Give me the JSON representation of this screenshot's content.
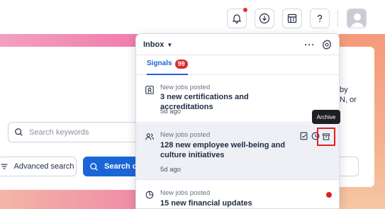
{
  "background": {
    "search_placeholder": "Search keywords",
    "advanced_search_label": "Advanced search",
    "search_button_label": "Search c",
    "right_text_lines": [
      "by",
      "N, or"
    ]
  },
  "inbox": {
    "title": "Inbox",
    "tab_label": "Signals",
    "tab_count": "99",
    "tooltip": "Archive",
    "items": [
      {
        "kicker": "New jobs posted",
        "title": "3 new certifications and accreditations",
        "time": "5d ago"
      },
      {
        "kicker": "New jobs posted",
        "title": "128 new employee well-being and culture initiatives",
        "time": "5d ago"
      },
      {
        "kicker": "New jobs posted",
        "title": "15 new financial updates",
        "time": ""
      }
    ]
  },
  "colors": {
    "accent": "#1a66d6",
    "badge": "#d92d2d",
    "highlight_frame": "#e02020"
  },
  "icons": [
    "bell-icon",
    "download-icon",
    "building-icon",
    "help-icon",
    "avatar",
    "more-icon",
    "gear-icon",
    "certificate-icon",
    "people-icon",
    "pie-chart-icon",
    "edit-icon",
    "clock-icon",
    "archive-icon",
    "search-icon",
    "filter-icon"
  ]
}
